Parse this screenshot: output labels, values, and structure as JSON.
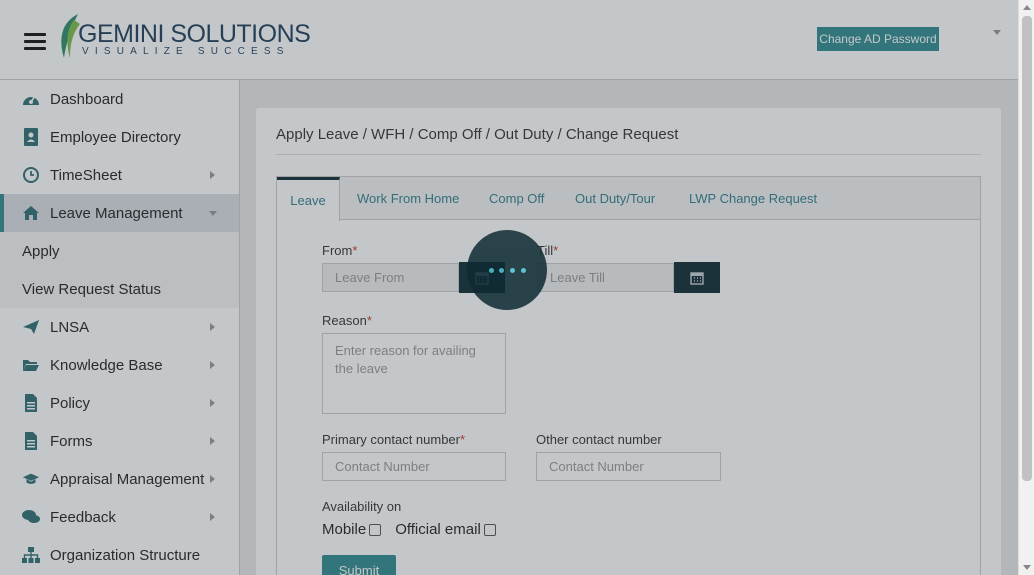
{
  "header": {
    "logo_name": "GEMINI SOLUTIONS",
    "logo_tagline": "VISUALIZE SUCCESS",
    "change_password_label": "Change AD Password"
  },
  "sidebar": {
    "items": [
      {
        "label": "Dashboard",
        "icon": "dashboard-icon"
      },
      {
        "label": "Employee Directory",
        "icon": "address-book-icon"
      },
      {
        "label": "TimeSheet",
        "icon": "clock-icon"
      },
      {
        "label": "Leave Management",
        "icon": "home-icon"
      },
      {
        "label": "LNSA",
        "icon": "paper-plane-icon"
      },
      {
        "label": "Knowledge Base",
        "icon": "folder-open-icon"
      },
      {
        "label": "Policy",
        "icon": "file-text-icon"
      },
      {
        "label": "Forms",
        "icon": "file-text-icon"
      },
      {
        "label": "Appraisal Management",
        "icon": "graduation-cap-icon"
      },
      {
        "label": "Feedback",
        "icon": "comments-icon"
      },
      {
        "label": "Organization Structure",
        "icon": "sitemap-icon"
      }
    ],
    "sub_items": [
      {
        "label": "Apply"
      },
      {
        "label": "View Request Status"
      }
    ]
  },
  "main": {
    "page_title": "Apply Leave / WFH / Comp Off / Out Duty / Change Request",
    "tabs": [
      {
        "label": "Leave"
      },
      {
        "label": "Work From Home"
      },
      {
        "label": "Comp Off"
      },
      {
        "label": "Out Duty/Tour"
      },
      {
        "label": "LWP Change Request"
      }
    ],
    "form": {
      "from_label": "From",
      "from_placeholder": "Leave From",
      "till_label": "Till",
      "till_placeholder": "Leave Till",
      "required_mark": "*",
      "reason_label": "Reason",
      "reason_placeholder": "Enter reason for availing the leave",
      "primary_contact_label": "Primary contact number",
      "primary_contact_placeholder": "Contact Number",
      "other_contact_label": "Other contact number",
      "other_contact_placeholder": "Contact Number",
      "availability_label": "Availability on",
      "mobile_label": "Mobile",
      "official_email_label": "Official email",
      "submit_label": "Submit"
    }
  },
  "colors": {
    "accent": "#2e8c8e",
    "dark": "#0f2a33",
    "loader_dot": "#49c6d4"
  }
}
